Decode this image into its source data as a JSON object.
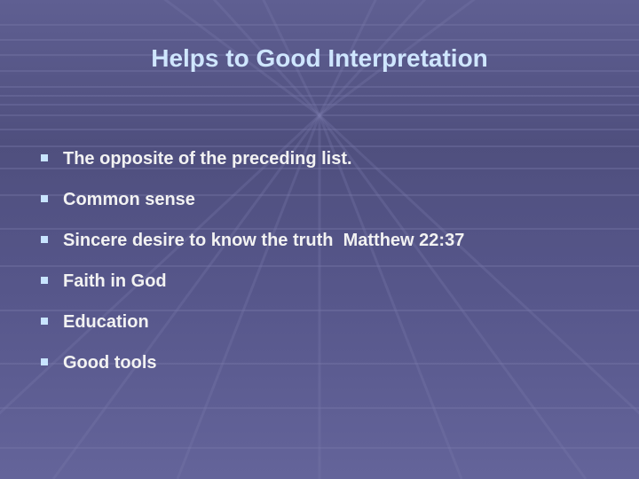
{
  "slide": {
    "title": "Helps to Good Interpretation",
    "bullets": [
      "The opposite of the preceding list.",
      "Common sense",
      "Sincere desire to know the truth  Matthew 22:37",
      "Faith in God",
      "Education",
      "Good tools"
    ],
    "bullet_icon": "square-bullet-icon",
    "colors": {
      "background": "#56568a",
      "title": "#cfe6ff",
      "text": "#f2f2f2",
      "bullet": "#c8e4ff"
    }
  }
}
